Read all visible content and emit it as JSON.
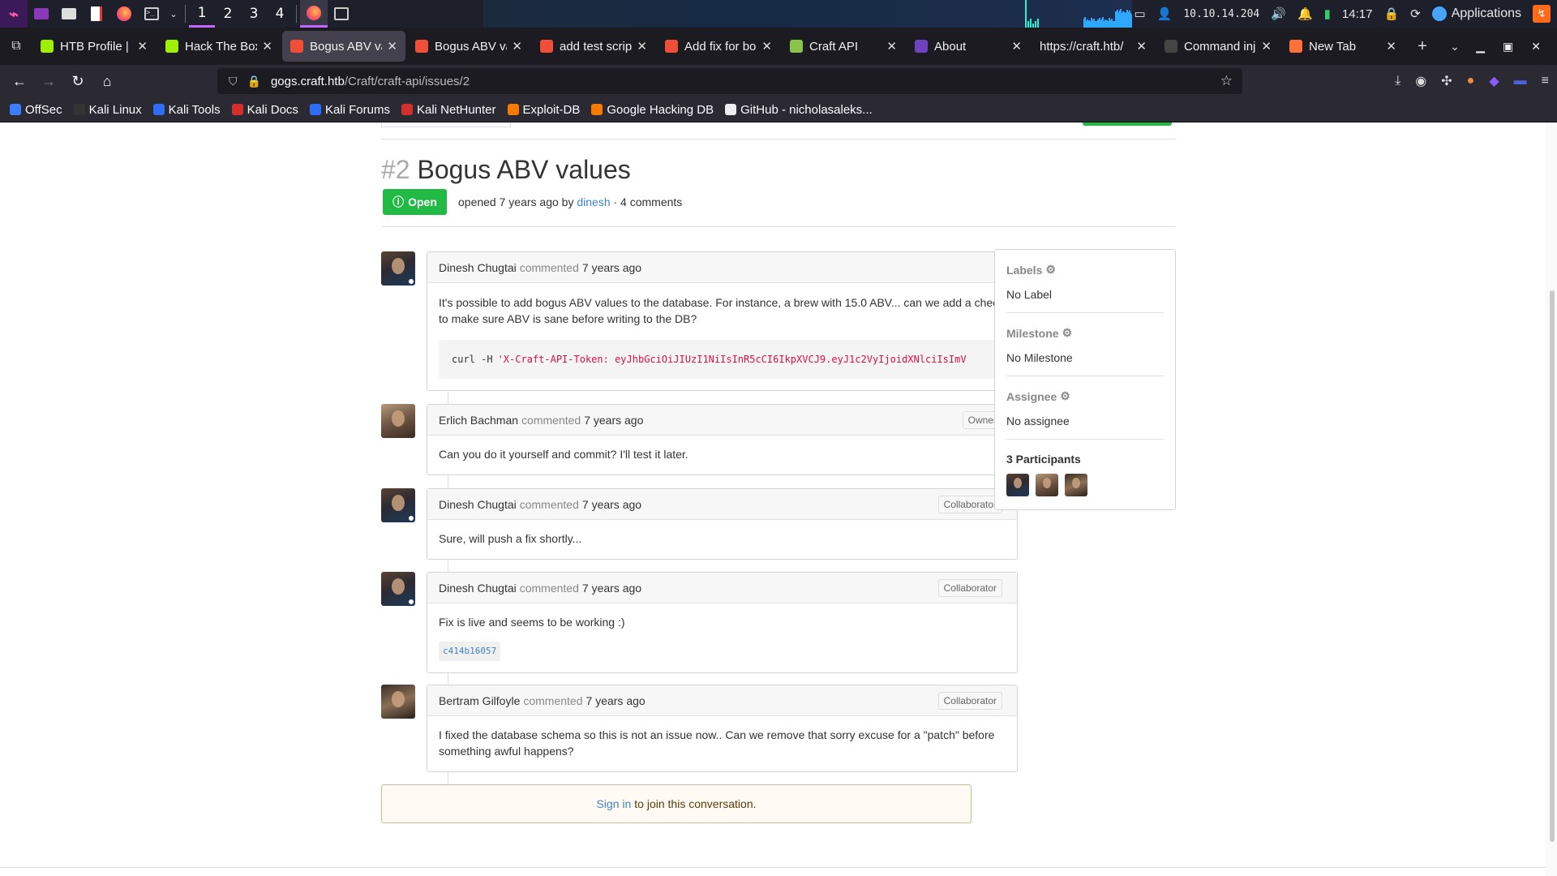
{
  "panel": {
    "workspaces": [
      "1",
      "2",
      "3",
      "4"
    ],
    "ip": "10.10.14.204",
    "clock": "14:17",
    "apps_label": "Applications"
  },
  "tabs": [
    {
      "label": "HTB Profile | H",
      "favicon": "htb-cube-icon",
      "color": "#9fef00"
    },
    {
      "label": "Hack The Box :",
      "favicon": "htb-cube-icon",
      "color": "#9fef00"
    },
    {
      "label": "Bogus ABV val",
      "favicon": "gogs-icon",
      "color": "#f04e37",
      "active": true
    },
    {
      "label": "Bogus ABV val",
      "favicon": "gogs-icon",
      "color": "#f04e37"
    },
    {
      "label": "add test script",
      "favicon": "gogs-icon",
      "color": "#f04e37"
    },
    {
      "label": "Add fix for bog",
      "favicon": "gogs-icon",
      "color": "#f04e37"
    },
    {
      "label": "Craft API",
      "favicon": "craft-icon",
      "color": "#8bc34a"
    },
    {
      "label": "About",
      "favicon": "bootstrap-icon",
      "color": "#6f42c1"
    },
    {
      "label": "https://craft.htb/",
      "favicon": "",
      "color": ""
    },
    {
      "label": "Command inje",
      "favicon": "hacktricks-icon",
      "color": "#444"
    },
    {
      "label": "New Tab",
      "favicon": "firefox-icon",
      "color": "#ff7139"
    }
  ],
  "nav": {
    "url_host": "gogs.craft.htb",
    "url_path": "/Craft/craft-api/issues/2"
  },
  "bookmarks": [
    {
      "label": "OffSec",
      "color": "#3d7eff"
    },
    {
      "label": "Kali Linux",
      "color": "#333"
    },
    {
      "label": "Kali Tools",
      "color": "#2f6df6"
    },
    {
      "label": "Kali Docs",
      "color": "#d32f2f"
    },
    {
      "label": "Kali Forums",
      "color": "#2f6df6"
    },
    {
      "label": "Kali NetHunter",
      "color": "#d32f2f"
    },
    {
      "label": "Exploit-DB",
      "color": "#f57c00"
    },
    {
      "label": "Google Hacking DB",
      "color": "#f57c00"
    },
    {
      "label": "GitHub - nicholasaleks...",
      "color": "#eee"
    }
  ],
  "issue": {
    "number": "#2",
    "title": "Bogus ABV values",
    "status": "Open",
    "opened": "opened 7 years ago by",
    "author": "dinesh",
    "comments_count": "· 4 comments"
  },
  "comments": [
    {
      "author": "Dinesh Chugtai",
      "verb": "commented",
      "time": "7 years ago",
      "role": "",
      "body": "It's possible to add bogus ABV values to the database. For instance, a brew with 15.0 ABV... can we add a check to make sure ABV is sane before writing to the DB?",
      "code_cmd": "curl -H",
      "code_arg": "'X-Craft-API-Token: eyJhbGciOiJIUzI1NiIsInR5cCI6IkpXVCJ9.eyJ1c2VyIjoidXNlciIsImV"
    },
    {
      "author": "Erlich Bachman",
      "verb": "commented",
      "time": "7 years ago",
      "role": "Owner",
      "body": "Can you do it yourself and commit? I'll test it later."
    },
    {
      "author": "Dinesh Chugtai",
      "verb": "commented",
      "time": "7 years ago",
      "role": "Collaborator",
      "body": "Sure, will push a fix shortly..."
    },
    {
      "author": "Dinesh Chugtai",
      "verb": "commented",
      "time": "7 years ago",
      "role": "Collaborator",
      "body": "Fix is live and seems to be working :)",
      "commit": "c414b16057"
    },
    {
      "author": "Bertram Gilfoyle",
      "verb": "commented",
      "time": "7 years ago",
      "role": "Collaborator",
      "body": "I fixed the database schema so this is not an issue now.. Can we remove that sorry excuse for a \"patch\" before something awful happens?"
    }
  ],
  "signin": {
    "link": "Sign in",
    "text": "to join this conversation."
  },
  "sidebar": {
    "labels_h": "Labels",
    "labels_v": "No Label",
    "milestone_h": "Milestone",
    "milestone_v": "No Milestone",
    "assignee_h": "Assignee",
    "assignee_v": "No assignee",
    "participants_h": "3 Participants"
  }
}
